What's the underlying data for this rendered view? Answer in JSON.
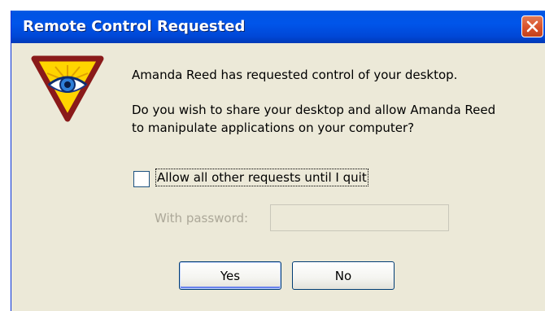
{
  "window": {
    "title": "Remote Control Requested",
    "close_icon": "close-icon"
  },
  "app_icon": "eye-triangle-icon",
  "messages": {
    "line1": "Amanda Reed has requested control of your desktop.",
    "line2": "Do you wish to share your desktop and allow Amanda Reed",
    "line3": "to manipulate applications on your computer?"
  },
  "options": {
    "allow_all_label": "Allow all other requests until I quit",
    "allow_all_checked": false,
    "password_label": "With password:",
    "password_value": "",
    "password_enabled": false
  },
  "buttons": {
    "yes_label": "Yes",
    "no_label": "No"
  },
  "colors": {
    "titlebar": "#0054e3",
    "dialog_bg": "#ece9d8",
    "close_button": "#d9512a",
    "disabled_text": "#aca899"
  }
}
